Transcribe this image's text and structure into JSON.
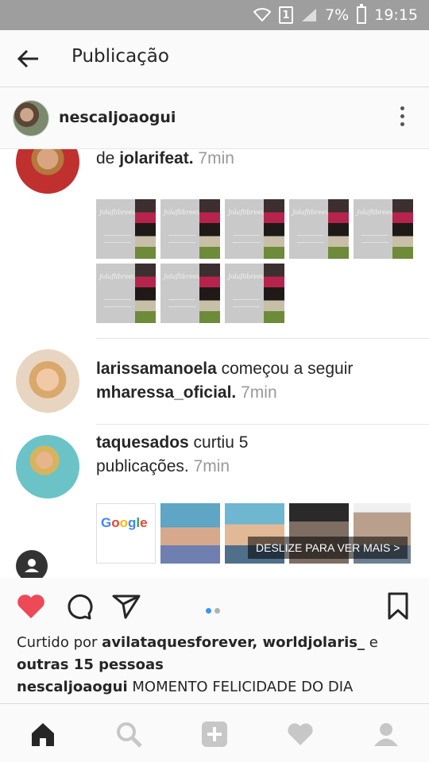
{
  "status_bar": {
    "sim": "1",
    "battery": "7%",
    "time": "19:15"
  },
  "header": {
    "title": "Publicação"
  },
  "post_owner": {
    "username": "nescaljoaogui"
  },
  "post_image": {
    "notifications": [
      {
        "text_prefix": "",
        "username": "",
        "line": "de",
        "target": "jolarifeat.",
        "time": "7min"
      },
      {
        "username": "larissamanoela",
        "action": "começou a seguir",
        "target": "mharessa_oficial.",
        "time": "7min"
      },
      {
        "username": "taquesados",
        "action_line1": "curtiu 5",
        "action_line2": "publicações.",
        "time": "7min"
      }
    ],
    "thumb_tag": "Jolaflibreeu",
    "google_text": "Google",
    "swipe_label": "DESLIZE PARA VER MAIS >"
  },
  "actions": {
    "like": "heart-icon",
    "comment": "comment-icon",
    "share": "direct-icon",
    "save": "bookmark-icon"
  },
  "likes": {
    "prefix": "Curtido por",
    "users": "avilataquesforever, worldjolaris_",
    "and": "e",
    "others": "outras 15 pessoas"
  },
  "caption": {
    "username": "nescaljoaogui",
    "text": "MOMENTO FELICIDADE DO DIA"
  },
  "colors": {
    "like_red": "#ed4956",
    "active_dot": "#3897f0",
    "status_bar": "#9e9e9e"
  }
}
